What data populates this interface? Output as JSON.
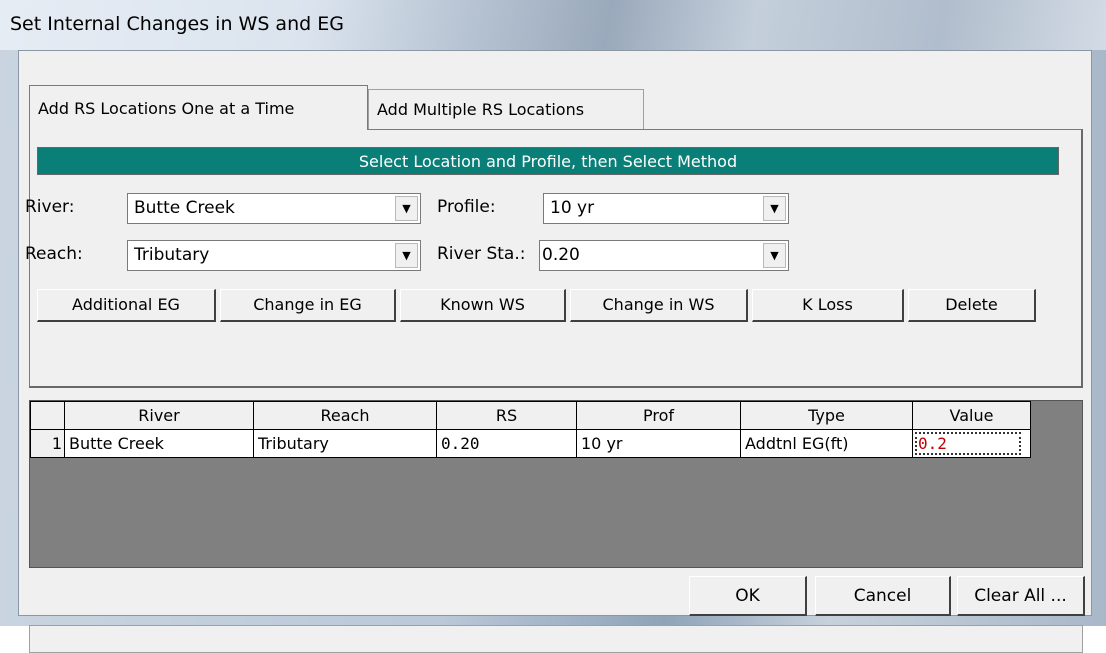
{
  "window": {
    "title": "Set Internal Changes in WS and EG"
  },
  "tabs": [
    {
      "label": "Add RS Locations One at a Time",
      "active": true
    },
    {
      "label": "Add Multiple RS Locations",
      "active": false
    }
  ],
  "header": {
    "text": "Select Location and Profile, then Select Method"
  },
  "fields": {
    "river": {
      "label": "River:",
      "value": "Butte Creek"
    },
    "reach": {
      "label": "Reach:",
      "value": "Tributary"
    },
    "profile": {
      "label": "Profile:",
      "value": "10 yr"
    },
    "river_sta": {
      "label": "River Sta.:",
      "value": "0.20"
    }
  },
  "method_buttons": [
    "Additional EG",
    "Change in EG",
    "Known WS",
    "Change in WS",
    "K Loss",
    "Delete"
  ],
  "table": {
    "columns": [
      "River",
      "Reach",
      "RS",
      "Prof",
      "Type",
      "Value"
    ],
    "rows": [
      {
        "num": "1",
        "river": "Butte Creek",
        "reach": "Tributary",
        "rs": "0.20",
        "prof": "10 yr",
        "type": "Addtnl EG(ft)",
        "value": "0.2"
      }
    ]
  },
  "dialog_buttons": {
    "ok": "OK",
    "cancel": "Cancel",
    "clear_all": "Clear All ..."
  },
  "colors": {
    "header_bar": "#0a7f78",
    "grid_background": "#808080",
    "value_text": "#c00000"
  }
}
